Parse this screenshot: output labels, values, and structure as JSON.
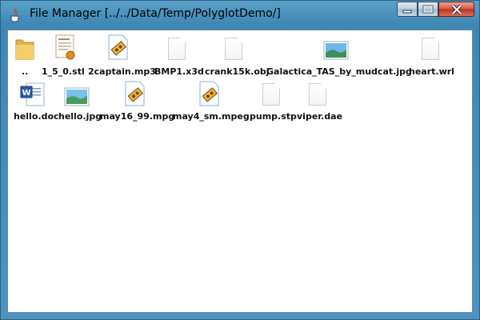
{
  "window": {
    "title": "File Manager [../../Data/Temp/PolyglotDemo/]",
    "controls": {
      "minimize_icon": "minimize-icon",
      "maximize_icon": "maximize-icon",
      "close_icon": "close-icon"
    }
  },
  "files": [
    {
      "name": "..",
      "icon": "folder-icon"
    },
    {
      "name": "1_5_0.stl",
      "icon": "certificate-document-icon"
    },
    {
      "name": "2captain.mp3",
      "icon": "media-file-icon"
    },
    {
      "name": "BMP1.x3d",
      "icon": "generic-file-icon"
    },
    {
      "name": "crank15k.obj",
      "icon": "generic-file-icon"
    },
    {
      "name": "Galactica_TAS_by_mudcat.jpg",
      "icon": "image-file-icon"
    },
    {
      "name": "heart.wrl",
      "icon": "generic-file-icon"
    },
    {
      "name": "hello.doc",
      "icon": "word-document-icon"
    },
    {
      "name": "hello.jpg",
      "icon": "image-file-icon"
    },
    {
      "name": "may16_99.mpg",
      "icon": "media-file-icon"
    },
    {
      "name": "may4_sm.mpeg",
      "icon": "media-file-icon"
    },
    {
      "name": "pump.stp",
      "icon": "generic-file-icon"
    },
    {
      "name": "viper.dae",
      "icon": "generic-file-icon"
    }
  ],
  "colors": {
    "titlebar": "#4e93bf",
    "close_button": "#c0321b",
    "content_bg": "#ffffff"
  }
}
